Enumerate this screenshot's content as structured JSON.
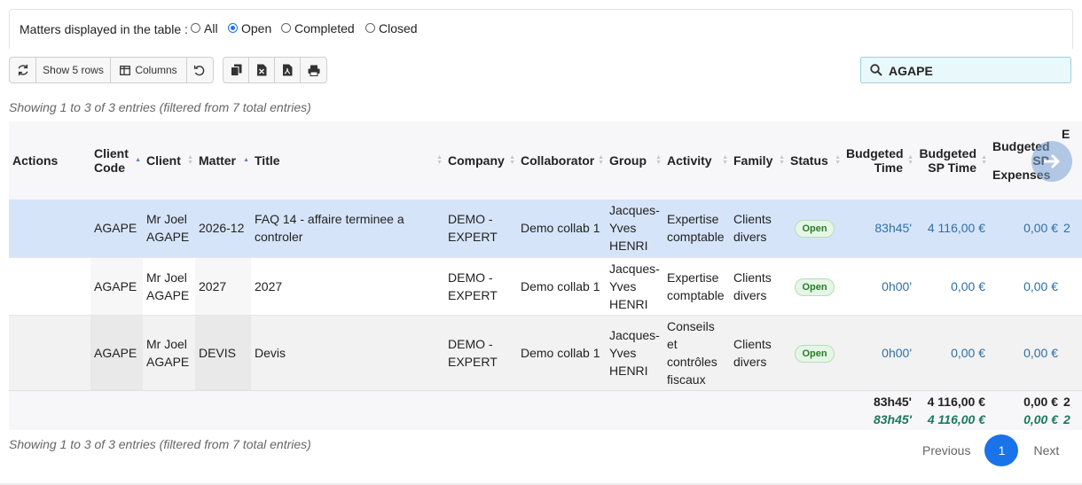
{
  "filter": {
    "label": "Matters displayed in the table :",
    "options": [
      "All",
      "Open",
      "Completed",
      "Closed"
    ],
    "selected": "Open"
  },
  "toolbar": {
    "refresh_icon": "refresh-icon",
    "show_rows_label": "Show 5 rows",
    "columns_label": "Columns",
    "reset_icon": "undo-icon",
    "copy_icon": "copy-icon",
    "excel_icon": "excel-icon",
    "pdf_icon": "pdf-icon",
    "print_icon": "print-icon"
  },
  "search": {
    "value": "AGAPE"
  },
  "info": {
    "top": "Showing 1 to 3 of 3 entries (filtered from 7 total entries)",
    "bottom": "Showing 1 to 3 of 3 entries (filtered from 7 total entries)"
  },
  "table": {
    "headers": {
      "actions": "Actions",
      "client_code_1": "Client",
      "client_code_2": "Code",
      "client": "Client",
      "matter": "Matter",
      "title": "Title",
      "company": "Company",
      "collaborator": "Collaborator",
      "group": "Group",
      "activity": "Activity",
      "family": "Family",
      "status": "Status",
      "budgeted_time_1": "Budgeted",
      "budgeted_time_2": "Time",
      "budgeted_sp_time_1": "Budgeted",
      "budgeted_sp_time_2": "SP Time",
      "budgeted_sp_exp_1": "Budgeted",
      "budgeted_sp_exp_2": "SP",
      "budgeted_sp_exp_3": "Expenses",
      "next_col": "E"
    },
    "rows": [
      {
        "client_code": "AGAPE",
        "client_1": "Mr Joel",
        "client_2": "AGAPE",
        "matter": "2026-12",
        "title_1": "FAQ 14 - affaire terminee a",
        "title_2": "controler",
        "company_1": "DEMO -",
        "company_2": "EXPERT",
        "collaborator": "Demo collab 1",
        "group_1": "Jacques-",
        "group_2": "Yves",
        "group_3": "HENRI",
        "activity_1": "Expertise",
        "activity_2": "comptable",
        "activity_3": "",
        "activity_4": "",
        "family_1": "Clients",
        "family_2": "divers",
        "status": "Open",
        "budgeted_time": "83h45'",
        "budgeted_sp_time": "4 116,00 €",
        "budgeted_sp_expenses": "0,00 €",
        "next": "2"
      },
      {
        "client_code": "AGAPE",
        "client_1": "Mr Joel",
        "client_2": "AGAPE",
        "matter": "2027",
        "title_1": "2027",
        "title_2": "",
        "company_1": "DEMO -",
        "company_2": "EXPERT",
        "collaborator": "Demo collab 1",
        "group_1": "Jacques-",
        "group_2": "Yves",
        "group_3": "HENRI",
        "activity_1": "Expertise",
        "activity_2": "comptable",
        "activity_3": "",
        "activity_4": "",
        "family_1": "Clients",
        "family_2": "divers",
        "status": "Open",
        "budgeted_time": "0h00'",
        "budgeted_sp_time": "0,00 €",
        "budgeted_sp_expenses": "0,00 €",
        "next": ""
      },
      {
        "client_code": "AGAPE",
        "client_1": "Mr Joel",
        "client_2": "AGAPE",
        "matter": "DEVIS",
        "title_1": "Devis",
        "title_2": "",
        "company_1": "DEMO -",
        "company_2": "EXPERT",
        "collaborator": "Demo collab 1",
        "group_1": "Jacques-",
        "group_2": "Yves",
        "group_3": "HENRI",
        "activity_1": "Conseils",
        "activity_2": "et",
        "activity_3": "contrôles",
        "activity_4": "fiscaux",
        "family_1": "Clients",
        "family_2": "divers",
        "status": "Open",
        "budgeted_time": "0h00'",
        "budgeted_sp_time": "0,00 €",
        "budgeted_sp_expenses": "0,00 €",
        "next": ""
      }
    ],
    "totals": {
      "budgeted_time": "83h45'",
      "budgeted_time_sub": "83h45'",
      "budgeted_sp_time": "4 116,00 €",
      "budgeted_sp_time_sub": "4 116,00 €",
      "budgeted_sp_expenses": "0,00 €",
      "budgeted_sp_expenses_sub": "0,00 €",
      "next": "2",
      "next_sub": "2"
    }
  },
  "pagination": {
    "previous": "Previous",
    "page": "1",
    "next": "Next"
  },
  "colors": {
    "accent": "#1a73e8",
    "selected_row": "#d6e4f9",
    "search_bg": "#e9f8fa",
    "value_blue": "#2f6fa7"
  }
}
